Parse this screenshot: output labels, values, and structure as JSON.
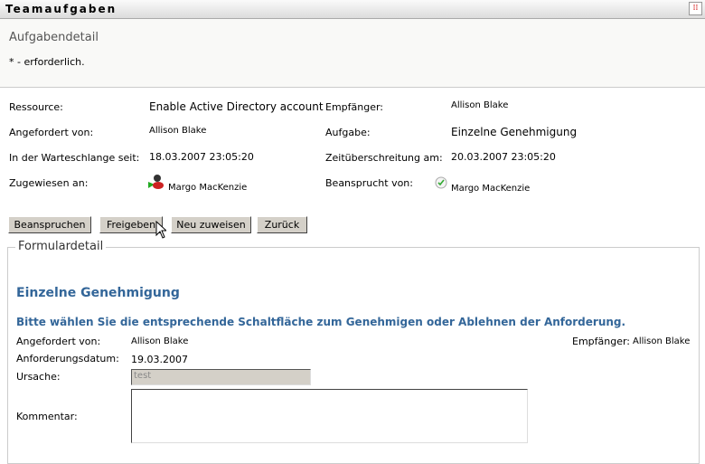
{
  "header": {
    "title": "Teamaufgaben"
  },
  "top": {
    "subtitle": "Aufgabendetail",
    "required_note": "* - erforderlich."
  },
  "details": {
    "ressource_label": "Ressource:",
    "ressource_value": "Enable Active Directory account",
    "empfaenger_label": "Empfänger:",
    "empfaenger_value": "Allison Blake",
    "angefordert_label": "Angefordert von:",
    "angefordert_value": "Allison Blake",
    "aufgabe_label": "Aufgabe:",
    "aufgabe_value": "Einzelne Genehmigung",
    "warteschlange_label": "In der Warteschlange seit:",
    "warteschlange_value": "18.03.2007 23:05:20",
    "zeit_label": "Zeitüberschreitung am:",
    "zeit_value": "20.03.2007 23:05:20",
    "zugewiesen_label": "Zugewiesen an:",
    "zugewiesen_value": "Margo MacKenzie",
    "beansprucht_label": "Beansprucht von:",
    "beansprucht_value": "Margo MacKenzie"
  },
  "buttons": {
    "claim": "Beanspruchen",
    "release": "Freigeben",
    "reassign": "Neu zuweisen",
    "back": "Zurück"
  },
  "form": {
    "legend": "Formulardetail",
    "heading": "Einzelne Genehmigung",
    "instruction": "Bitte wählen Sie die entsprechende Schaltfläche zum Genehmigen oder Ablehnen der Anforderung.",
    "angefordert_label": "Angefordert von:",
    "angefordert_value": "Allison Blake",
    "empfaenger_label": "Empfänger:",
    "empfaenger_value": "Allison Blake",
    "datum_label": "Anforderungsdatum:",
    "datum_value": "19.03.2007",
    "ursache_label": "Ursache:",
    "ursache_value": "test",
    "kommentar_label": "Kommentar:",
    "kommentar_value": ""
  }
}
